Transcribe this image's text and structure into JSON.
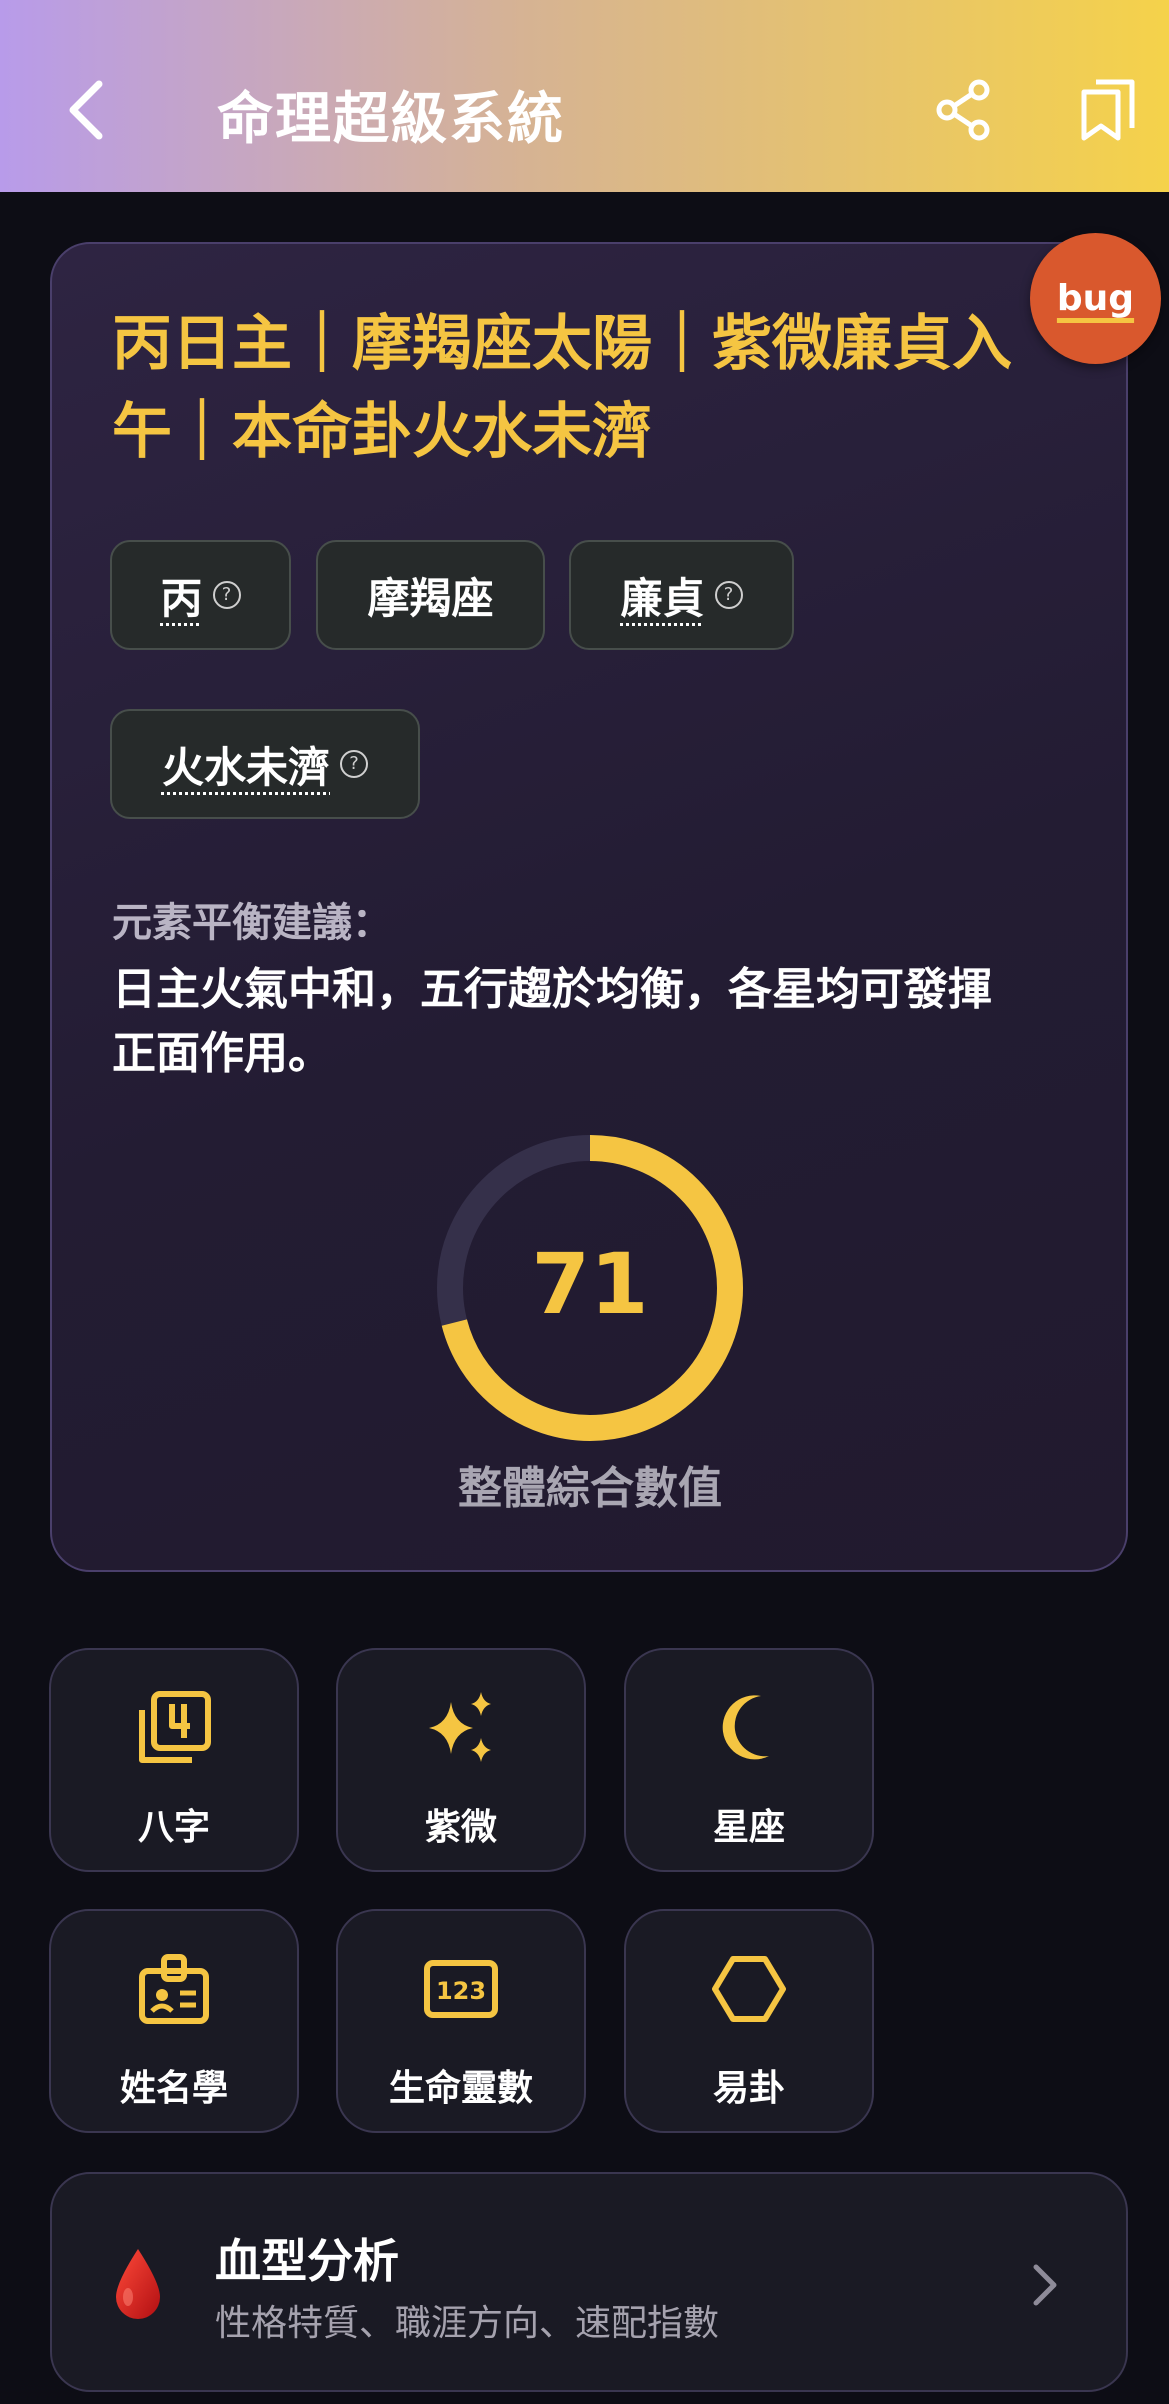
{
  "header": {
    "title": "命理超級系統"
  },
  "debug": {
    "label": "bug"
  },
  "summary": {
    "headline_line1": "丙日主｜摩羯座太陽｜紫微廉貞入",
    "headline_line2": "午｜本命卦火水未濟",
    "chips": [
      {
        "label": "丙",
        "has_help": true
      },
      {
        "label": "摩羯座",
        "has_help": false
      },
      {
        "label": "廉貞",
        "has_help": true
      },
      {
        "label": "火水未濟",
        "has_help": true
      }
    ],
    "help_glyph": "?",
    "balance_label": "元素平衡建議：",
    "balance_line1": "日主火氣中和，五行趨於均衡，各星均可發揮",
    "balance_line2": "正面作用。",
    "score": 71,
    "score_max": 100,
    "score_label": "整體綜合數值",
    "accent_color": "#f5c542"
  },
  "modules": [
    {
      "label": "八字",
      "icon": "square-four-icon"
    },
    {
      "label": "紫微",
      "icon": "sparkles-icon"
    },
    {
      "label": "星座",
      "icon": "moon-icon"
    },
    {
      "label": "姓名學",
      "icon": "id-badge-icon"
    },
    {
      "label": "生命靈數",
      "icon": "number-123-icon"
    },
    {
      "label": "易卦",
      "icon": "hexagon-icon"
    }
  ],
  "blood": {
    "title": "血型分析",
    "subtitle": "性格特質、職涯方向、速配指數"
  }
}
